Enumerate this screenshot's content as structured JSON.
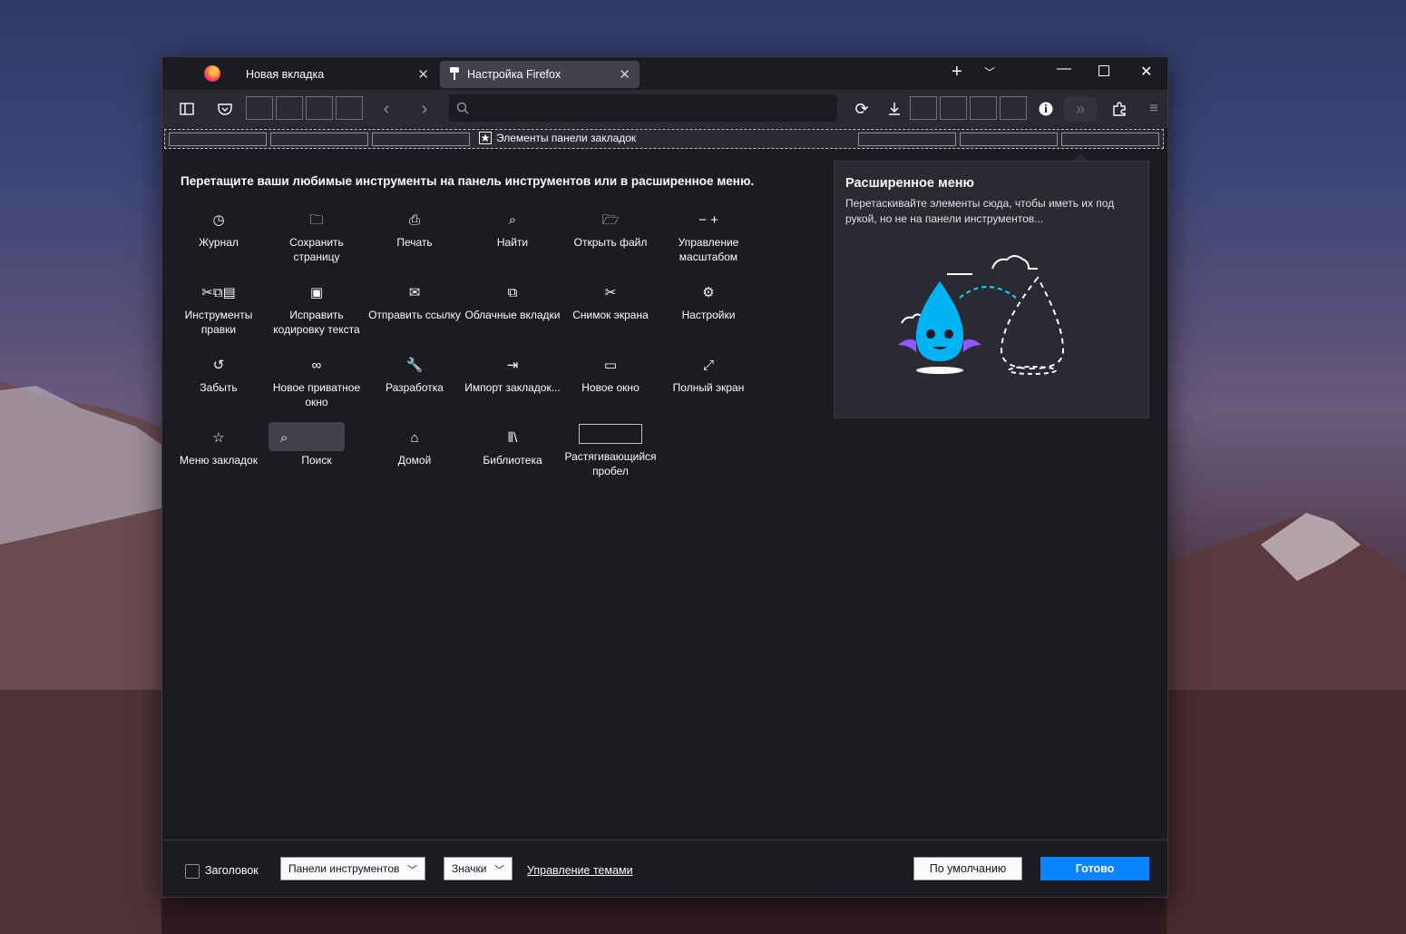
{
  "tabs": [
    {
      "label": "Новая вкладка"
    },
    {
      "label": "Настройка Firefox"
    }
  ],
  "hint": "Перетащите ваши любимые инструменты на панель инструментов или в расширенное меню.",
  "bookmarks_label": "Элементы панели закладок",
  "items": [
    {
      "label": "Журнал",
      "icon": "history-icon"
    },
    {
      "label": "Сохранить страницу",
      "icon": "save-page-icon"
    },
    {
      "label": "Печать",
      "icon": "print-icon"
    },
    {
      "label": "Найти",
      "icon": "find-icon"
    },
    {
      "label": "Открыть файл",
      "icon": "open-file-icon"
    },
    {
      "label": "Управление масштабом",
      "icon": "zoom-icon"
    },
    {
      "label": "Инструменты правки",
      "icon": "edit-tools-icon"
    },
    {
      "label": "Исправить кодировку текста",
      "icon": "encoding-icon"
    },
    {
      "label": "Отправить ссылку",
      "icon": "email-link-icon"
    },
    {
      "label": "Облачные вкладки",
      "icon": "synced-tabs-icon"
    },
    {
      "label": "Снимок экрана",
      "icon": "screenshot-icon"
    },
    {
      "label": "Настройки",
      "icon": "settings-icon"
    },
    {
      "label": "Забыть",
      "icon": "forget-icon"
    },
    {
      "label": "Новое приватное окно",
      "icon": "private-window-icon"
    },
    {
      "label": "Разработка",
      "icon": "developer-icon"
    },
    {
      "label": "Импорт закладок...",
      "icon": "import-icon"
    },
    {
      "label": "Новое окно",
      "icon": "new-window-icon"
    },
    {
      "label": "Полный экран",
      "icon": "fullscreen-icon"
    },
    {
      "label": "Меню закладок",
      "icon": "bookmarks-menu-icon"
    },
    {
      "label": "Поиск",
      "icon": "search-icon"
    },
    {
      "label": "Домой",
      "icon": "home-icon"
    },
    {
      "label": "Библиотека",
      "icon": "library-icon"
    },
    {
      "label": "Растягивающийся пробел",
      "icon": "flexible-space-icon"
    }
  ],
  "overflow": {
    "title": "Расширенное меню",
    "text": "Перетаскивайте элементы сюда, чтобы иметь их под рукой, но не на панели инструментов..."
  },
  "footer": {
    "titlebar": "Заголовок",
    "toolbars": "Панели инструментов",
    "density": "Значки",
    "themes": "Управление темами",
    "restore": "По умолчанию",
    "done": "Готово"
  },
  "colors": {
    "accent": "#0a84ff",
    "panel": "#2b2a33",
    "window": "#1c1b22"
  }
}
